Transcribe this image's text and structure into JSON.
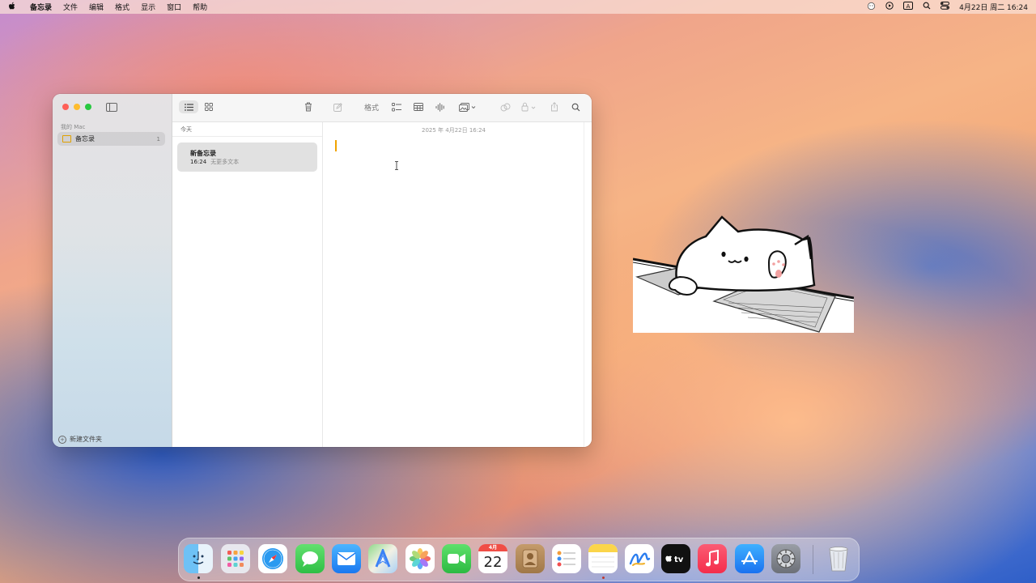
{
  "menubar": {
    "apple_glyph": "",
    "items": [
      "备忘录",
      "文件",
      "编辑",
      "格式",
      "显示",
      "窗口",
      "帮助"
    ],
    "clock": "4月22日 周二  16:24"
  },
  "sidebar": {
    "section": "我的 Mac",
    "folder_label": "备忘录",
    "folder_count": "1",
    "new_folder": "新建文件夹"
  },
  "toolbar": {
    "format_label": "格式"
  },
  "list": {
    "date_header": "今天",
    "note_title": "新备忘录",
    "note_time": "16:24",
    "note_preview": "无更多文本"
  },
  "editor": {
    "date": "2025 年 4月22日 16:24"
  },
  "dock": {
    "calendar_month": "4月",
    "calendar_day": "22",
    "apps": [
      "finder",
      "launchpad",
      "safari",
      "messages",
      "mail",
      "maps",
      "photos",
      "facetime",
      "calendar",
      "contacts",
      "reminders",
      "notes",
      "freeform",
      "tv",
      "music",
      "app-store",
      "system-settings",
      "trash"
    ]
  },
  "colors": {
    "accent": "#f0a300",
    "close": "#fe5f57",
    "minimize": "#febc2e",
    "zoom": "#28c840"
  }
}
